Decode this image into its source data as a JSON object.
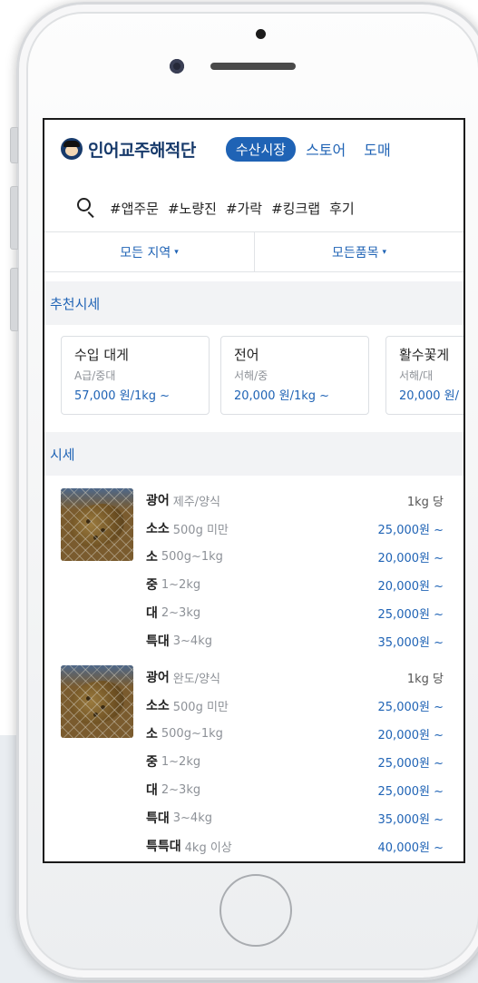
{
  "app": {
    "title": "인어교주해적단",
    "nav": [
      "수산시장",
      "스토어",
      "도매"
    ],
    "tags": [
      "#앱주문",
      "#노량진",
      "#가락",
      "#킹크랩",
      "후기"
    ],
    "filters": [
      "모든 지역",
      "모든품목"
    ],
    "filter_caret": "▾"
  },
  "recommended": {
    "heading": "추천시세",
    "items": [
      {
        "name": "수입 대게",
        "grade": "A급/중대",
        "price": "57,000 원/1kg ~"
      },
      {
        "name": "전어",
        "grade": "서해/중",
        "price": "20,000 원/1kg ~"
      },
      {
        "name": "활수꽃게",
        "grade": "서해/대",
        "price": "20,000 원/"
      }
    ]
  },
  "prices": {
    "heading": "시세",
    "groups": [
      {
        "name": "광어",
        "origin": "제주/양식",
        "unit": "1kg 당",
        "rows": [
          {
            "size": "소소",
            "range": "500g 미만",
            "price": "25,000원 ~"
          },
          {
            "size": "소",
            "range": "500g~1kg",
            "price": "20,000원 ~"
          },
          {
            "size": "중",
            "range": "1~2kg",
            "price": "20,000원 ~"
          },
          {
            "size": "대",
            "range": "2~3kg",
            "price": "25,000원 ~"
          },
          {
            "size": "특대",
            "range": "3~4kg",
            "price": "35,000원 ~"
          }
        ]
      },
      {
        "name": "광어",
        "origin": "완도/양식",
        "unit": "1kg 당",
        "rows": [
          {
            "size": "소소",
            "range": "500g 미만",
            "price": "25,000원 ~"
          },
          {
            "size": "소",
            "range": "500g~1kg",
            "price": "20,000원 ~"
          },
          {
            "size": "중",
            "range": "1~2kg",
            "price": "25,000원 ~"
          },
          {
            "size": "대",
            "range": "2~3kg",
            "price": "25,000원 ~"
          },
          {
            "size": "특대",
            "range": "3~4kg",
            "price": "35,000원 ~"
          },
          {
            "size": "특특대",
            "range": "4kg 이상",
            "price": "40,000원 ~"
          }
        ]
      }
    ]
  },
  "colors": {
    "accent": "#1f63b5",
    "brand": "#173a6b",
    "section_bg": "#f2f3f5"
  }
}
